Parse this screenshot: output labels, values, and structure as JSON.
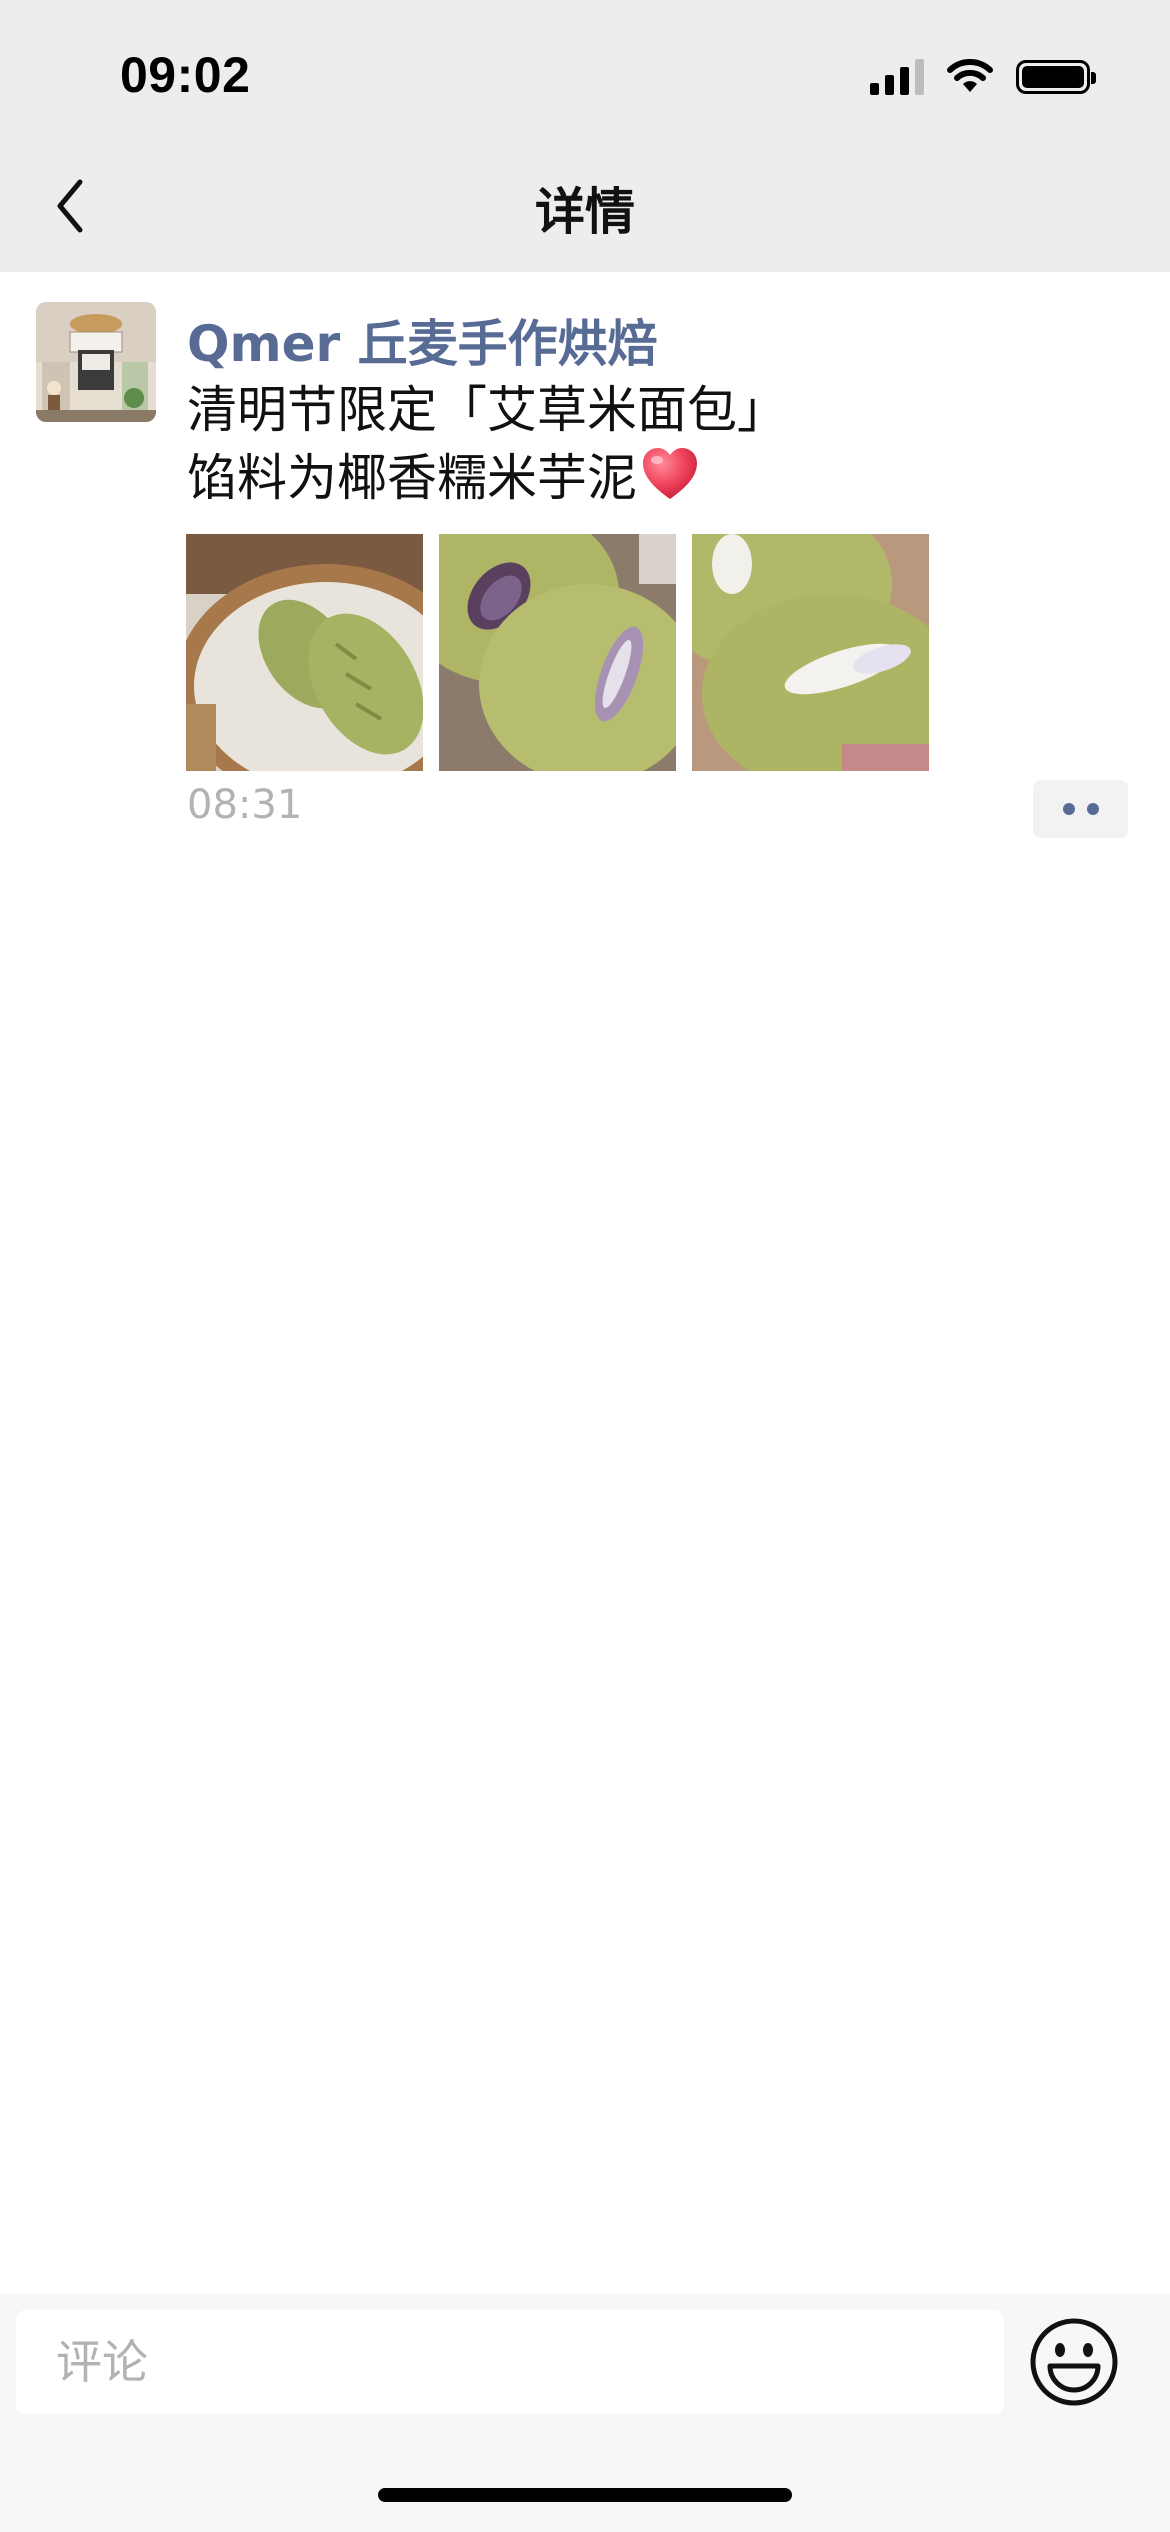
{
  "status_bar": {
    "time": "09:02",
    "signal_icon": "cellular-signal-icon",
    "wifi_icon": "wifi-icon",
    "battery_icon": "battery-icon"
  },
  "nav": {
    "back_icon": "chevron-left-icon",
    "title": "详情"
  },
  "post": {
    "author": "Qmer 丘麦手作烘焙",
    "text_line_1": "清明节限定「艾草米面包」",
    "text_line_2": "馅料为椰香糯米芋泥",
    "emoji": "heart-emoji",
    "photos": [
      "photo-1",
      "photo-2",
      "photo-3"
    ],
    "time": "08:31",
    "more_icon": "more-options-icon"
  },
  "comment": {
    "placeholder": "评论",
    "emoji_icon": "emoji-icon"
  },
  "colors": {
    "header_bg": "#EDEDED",
    "author_blue": "#576B95",
    "time_gray": "#B2B2B2",
    "bottom_bar_bg": "#F7F7F7"
  }
}
